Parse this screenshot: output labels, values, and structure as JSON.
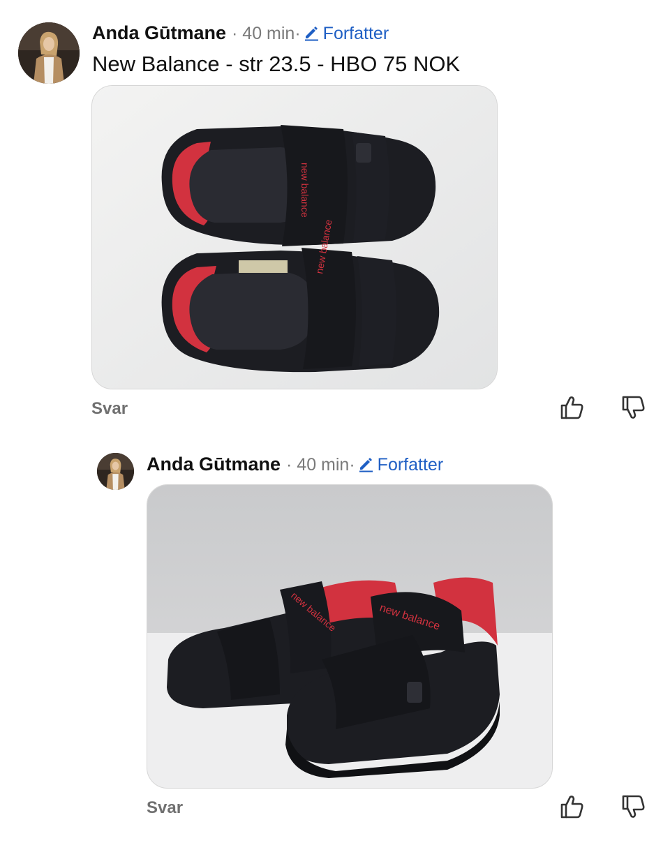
{
  "comments": [
    {
      "author": "Anda Gūtmane",
      "meta": "· 40 min·",
      "badge": "Forfatter",
      "text": "New Balance - str 23.5 - HBO 75 NOK",
      "reply_label": "Svar",
      "image": "sandals-top-view-photo"
    },
    {
      "author": "Anda Gūtmane",
      "meta": "· 40 min·",
      "badge": "Forfatter",
      "text": "",
      "reply_label": "Svar",
      "image": "sandals-side-view-photo"
    }
  ],
  "shoe_brand_print": "new balance",
  "colors": {
    "author_badge": "#1f5fc4",
    "meta_gray": "#7a7a7a",
    "reply_gray": "#707070",
    "shoe_black": "#1c1d22",
    "shoe_accent": "#d2323f"
  },
  "icons": [
    "pencil-icon",
    "thumbs-up-icon",
    "thumbs-down-icon"
  ]
}
